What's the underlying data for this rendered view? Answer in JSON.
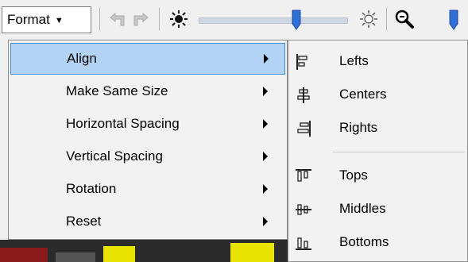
{
  "toolbar": {
    "format_label": "Format",
    "icons": [
      "undo-icon",
      "redo-icon",
      "brightness-low-icon",
      "brightness-slider",
      "brightness-high-icon",
      "zoom-icon",
      "zoom-slider"
    ]
  },
  "menu": {
    "items": [
      {
        "label": "Align",
        "has_submenu": true,
        "highlighted": true
      },
      {
        "label": "Make Same Size",
        "has_submenu": true
      },
      {
        "label": "Horizontal Spacing",
        "has_submenu": true
      },
      {
        "label": "Vertical Spacing",
        "has_submenu": true
      },
      {
        "label": "Rotation",
        "has_submenu": true
      },
      {
        "label": "Reset",
        "has_submenu": true
      }
    ]
  },
  "submenu": {
    "items": [
      {
        "label": "Lefts",
        "icon": "align-left-icon"
      },
      {
        "label": "Centers",
        "icon": "align-center-icon"
      },
      {
        "label": "Rights",
        "icon": "align-right-icon"
      },
      {
        "label": "Tops",
        "icon": "align-top-icon"
      },
      {
        "label": "Middles",
        "icon": "align-middle-icon"
      },
      {
        "label": "Bottoms",
        "icon": "align-bottom-icon"
      }
    ]
  },
  "colors": {
    "highlight_bg": "#b3d3f5",
    "highlight_border": "#3e8fe0",
    "slider_thumb": "#2f6fd6"
  }
}
